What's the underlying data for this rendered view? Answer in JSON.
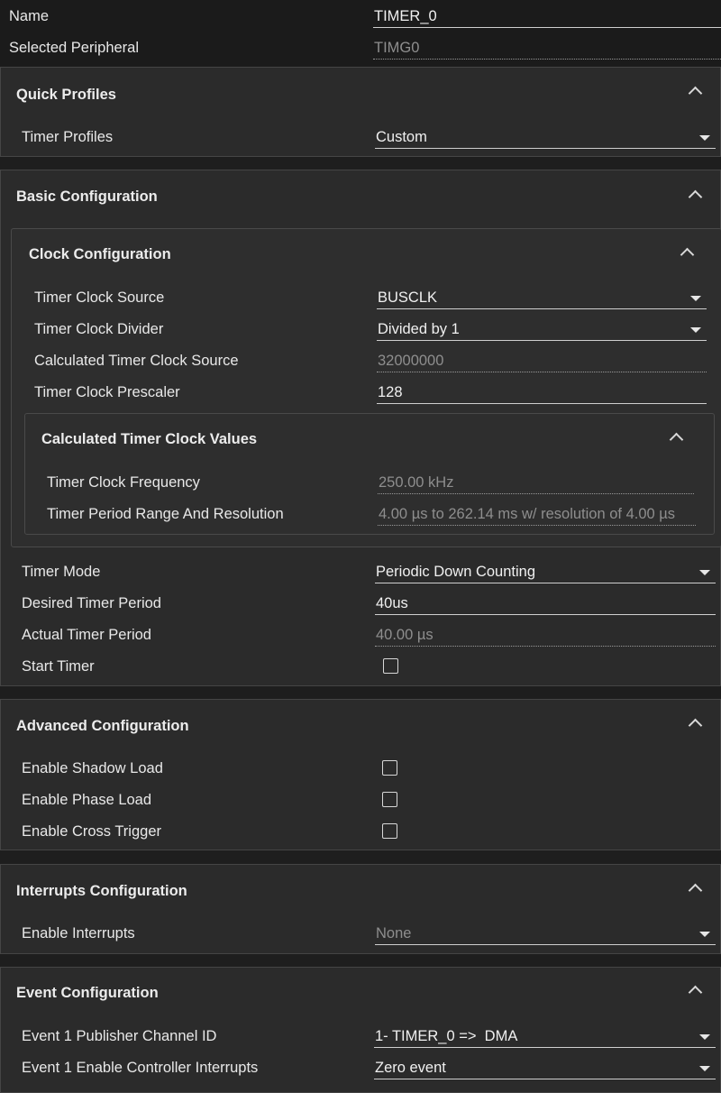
{
  "header": {
    "name_label": "Name",
    "name_value": "TIMER_0",
    "peripheral_label": "Selected Peripheral",
    "peripheral_value": "TIMG0"
  },
  "quick_profiles": {
    "title": "Quick Profiles",
    "timer_profiles_label": "Timer Profiles",
    "timer_profiles_value": "Custom"
  },
  "basic": {
    "title": "Basic Configuration",
    "clock": {
      "title": "Clock Configuration",
      "source_label": "Timer Clock Source",
      "source_value": "BUSCLK",
      "divider_label": "Timer Clock Divider",
      "divider_value": "Divided by 1",
      "calc_source_label": "Calculated Timer Clock Source",
      "calc_source_value": "32000000",
      "prescaler_label": "Timer Clock Prescaler",
      "prescaler_value": "128",
      "calc_values": {
        "title": "Calculated Timer Clock Values",
        "freq_label": "Timer Clock Frequency",
        "freq_value": "250.00 kHz",
        "range_label": "Timer Period Range And Resolution",
        "range_value": "4.00 µs to 262.14 ms w/ resolution of 4.00 µs"
      }
    },
    "mode_label": "Timer Mode",
    "mode_value": "Periodic Down Counting",
    "desired_label": "Desired Timer Period",
    "desired_value": "40us",
    "actual_label": "Actual Timer Period",
    "actual_value": "40.00 µs",
    "start_label": "Start Timer"
  },
  "advanced": {
    "title": "Advanced Configuration",
    "shadow_label": "Enable Shadow Load",
    "phase_label": "Enable Phase Load",
    "cross_label": "Enable Cross Trigger"
  },
  "interrupts": {
    "title": "Interrupts Configuration",
    "enable_label": "Enable Interrupts",
    "enable_value": "None"
  },
  "events": {
    "title": "Event Configuration",
    "pub_label": "Event 1 Publisher Channel ID",
    "pub_value": "1- TIMER_0 =>  DMA",
    "ctrl_label": "Event 1 Enable Controller Interrupts",
    "ctrl_value": "Zero event"
  }
}
